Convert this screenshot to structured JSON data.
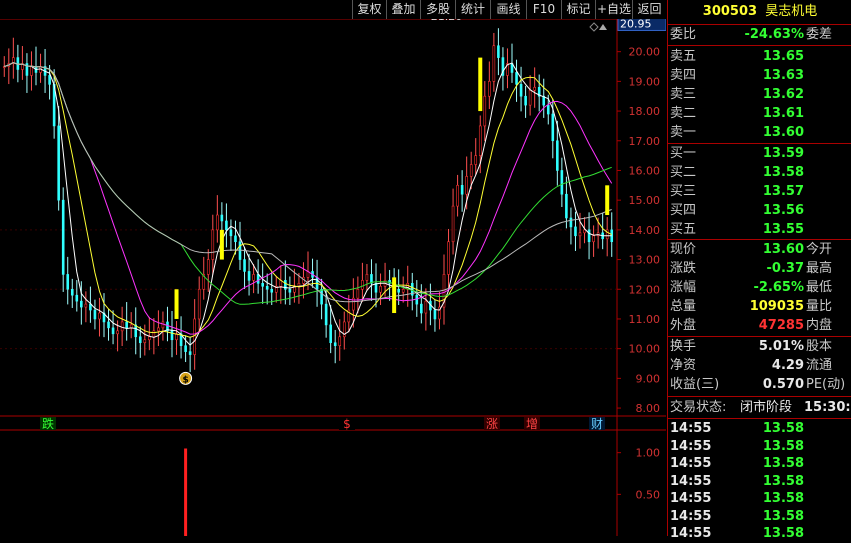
{
  "toolbar": {
    "buttons": [
      "复权",
      "叠加",
      "多股",
      "统计",
      "画线",
      "F10",
      "标记",
      "+自选",
      "返回"
    ]
  },
  "chart_data": {
    "type": "candlestick",
    "price_axis": {
      "min": 7.8,
      "max": 21.1,
      "ticks": [
        "20.00",
        "19.00",
        "18.00",
        "17.00",
        "16.00",
        "15.00",
        "14.00",
        "13.00",
        "12.00",
        "11.00",
        "10.00",
        "9.00",
        "8.00"
      ],
      "tick_values": [
        20,
        19,
        18,
        17,
        16,
        15,
        14,
        13,
        12,
        11,
        10,
        9,
        8
      ],
      "current_label": "20.95",
      "current_value": 20.95
    },
    "peak_annotation": {
      "text": "21.20",
      "value": 21.2,
      "index": 91
    },
    "close": [
      19.5,
      19.6,
      19.8,
      19.4,
      19.6,
      19.2,
      19.5,
      19.3,
      19.5,
      19.2,
      18.9,
      17.5,
      15.0,
      12.5,
      12.0,
      11.8,
      11.6,
      11.4,
      11.5,
      11.3,
      11.0,
      11.2,
      10.9,
      10.7,
      10.5,
      10.6,
      10.9,
      10.7,
      10.8,
      10.4,
      10.2,
      10.3,
      10.4,
      10.6,
      10.7,
      10.9,
      10.6,
      10.3,
      10.5,
      10.1,
      9.9,
      9.8,
      11.0,
      12.0,
      12.5,
      13.0,
      14.0,
      14.5,
      14.3,
      14.0,
      13.8,
      13.6,
      13.0,
      12.6,
      12.3,
      12.5,
      12.2,
      12.1,
      12.0,
      11.9,
      12.1,
      12.3,
      12.0,
      11.9,
      12.1,
      12.2,
      12.4,
      12.6,
      12.4,
      12.0,
      11.5,
      10.8,
      10.2,
      10.1,
      10.4,
      10.9,
      11.3,
      11.7,
      12.0,
      12.3,
      12.5,
      12.2,
      11.9,
      12.1,
      12.3,
      12.2,
      12.0,
      11.9,
      12.0,
      12.2,
      11.8,
      11.5,
      11.2,
      11.6,
      11.3,
      11.0,
      11.4,
      12.5,
      13.6,
      14.8,
      15.5,
      15.2,
      15.8,
      16.2,
      16.5,
      17.5,
      18.5,
      19.0,
      20.2,
      19.8,
      19.2,
      19.6,
      19.3,
      18.9,
      18.5,
      18.2,
      18.7,
      18.8,
      18.5,
      18.2,
      17.9,
      17.0,
      16.0,
      15.2,
      14.4,
      14.1,
      13.8,
      13.9,
      14.0,
      13.6,
      13.8,
      13.9,
      13.7,
      14.0,
      13.6
    ]
  },
  "markers": {
    "coin": {
      "text": "$",
      "index": 40
    },
    "bottom_labels": [
      {
        "text": "跌",
        "index": 12,
        "color": "#33ff33",
        "bg": "#003300"
      },
      {
        "text": "$",
        "index": 100,
        "color": "#ff3333",
        "bg": "#000"
      },
      {
        "text": "涨",
        "index": 136,
        "color": "#ff4444",
        "bg": "#330000"
      },
      {
        "text": "增",
        "index": 150,
        "color": "#ff4444",
        "bg": "#330000"
      },
      {
        "text": "财",
        "index": 168,
        "color": "#66ccff",
        "bg": "#001833"
      }
    ]
  },
  "volume_axis": {
    "ticks": [
      "1.00",
      "0.50"
    ],
    "tick_values": [
      1.0,
      0.5
    ],
    "max": 1.2
  },
  "volume_bar": {
    "index": 40,
    "value": 1.0
  },
  "right": {
    "stock_code": "300503",
    "stock_name": "昊志机电",
    "webi_label": "委比",
    "webi_value": "-24.63%",
    "weicha_label": "委差",
    "sell": [
      {
        "label": "卖五",
        "price": "13.65"
      },
      {
        "label": "卖四",
        "price": "13.63"
      },
      {
        "label": "卖三",
        "price": "13.62"
      },
      {
        "label": "卖二",
        "price": "13.61"
      },
      {
        "label": "卖一",
        "price": "13.60"
      }
    ],
    "buy": [
      {
        "label": "买一",
        "price": "13.59"
      },
      {
        "label": "买二",
        "price": "13.58"
      },
      {
        "label": "买三",
        "price": "13.57"
      },
      {
        "label": "买四",
        "price": "13.56"
      },
      {
        "label": "买五",
        "price": "13.55"
      }
    ],
    "quote": [
      {
        "label": "现价",
        "value": "13.60",
        "label2": "今开",
        "color": "#33ff33"
      },
      {
        "label": "涨跌",
        "value": "-0.37",
        "label2": "最高",
        "color": "#33ff33"
      },
      {
        "label": "涨幅",
        "value": "-2.65%",
        "label2": "最低",
        "color": "#33ff33"
      },
      {
        "label": "总量",
        "value": "109035",
        "label2": "量比",
        "color": "#ffff33"
      },
      {
        "label": "外盘",
        "value": "47285",
        "label2": "内盘",
        "color": "#ff3333"
      }
    ],
    "fin": [
      {
        "label": "换手",
        "value": "5.01%",
        "label2": "股本"
      },
      {
        "label": "净资",
        "value": "4.29",
        "label2": "流通"
      },
      {
        "label": "收益(三)",
        "value": "0.570",
        "label2": "PE(动)"
      }
    ],
    "status_label": "交易状态:",
    "status_value": "闭市阶段",
    "status_time": "15:30:0",
    "ticks": [
      {
        "time": "14:55",
        "price": "13.58"
      },
      {
        "time": "14:55",
        "price": "13.58"
      },
      {
        "time": "14:55",
        "price": "13.58"
      },
      {
        "time": "14:55",
        "price": "13.58"
      },
      {
        "time": "14:55",
        "price": "13.58"
      },
      {
        "time": "14:55",
        "price": "13.58"
      },
      {
        "time": "14:55",
        "price": "13.58"
      }
    ]
  }
}
